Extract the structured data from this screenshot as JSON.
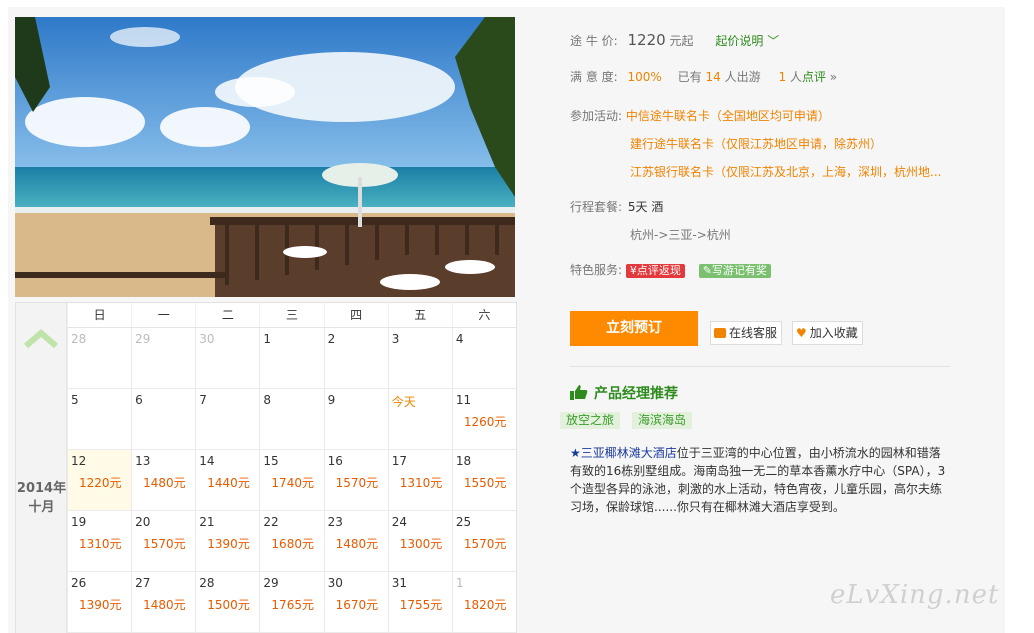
{
  "price_row": {
    "label": "途 牛 价:",
    "price": "1220",
    "unit": "元起",
    "explain": "起价说明"
  },
  "satisfaction_row": {
    "label": "满 意 度:",
    "percent": "100%",
    "prefix": "已有",
    "count": "14",
    "suffix": "人出游",
    "reviews_count": "1",
    "reviews_label": "人点评"
  },
  "activities": {
    "label": "参加活动:",
    "items": [
      "中信途牛联名卡（全国地区均可申请）",
      "建行途牛联名卡（仅限江苏地区申请，除苏州）",
      "江苏银行联名卡（仅限江苏及北京，上海，深圳，杭州地..."
    ]
  },
  "package": {
    "label": "行程套餐:",
    "value": "5天 酒",
    "route": "杭州->三亚->杭州"
  },
  "services": {
    "label": "特色服务:",
    "tag1": "¥点评返现",
    "tag2": "写游记有奖"
  },
  "actions": {
    "book": "立刻预订",
    "service": "在线客服",
    "favorite": "加入收藏"
  },
  "manager": {
    "title": "产品经理推荐",
    "tags": [
      "放空之旅",
      "海滨海岛"
    ],
    "desc_hotel": "★三亚椰林滩大酒店",
    "desc_text": "位于三亚湾的中心位置，由小桥流水的园林和错落有致的16栋别墅组成。海南岛独一无二的草本香薰水疗中心（SPA），3个造型各异的泳池，刺激的水上活动，特色宵夜，儿童乐园，高尔夫练习场，保龄球馆......你只有在椰林滩大酒店享受到。"
  },
  "calendar": {
    "year_label": "2014年",
    "month_label": "十月",
    "weekdays": [
      "日",
      "一",
      "二",
      "三",
      "四",
      "五",
      "六"
    ],
    "weeks": [
      [
        {
          "d": "28",
          "p": "",
          "other": true
        },
        {
          "d": "29",
          "p": "",
          "other": true
        },
        {
          "d": "30",
          "p": "",
          "other": true
        },
        {
          "d": "1",
          "p": ""
        },
        {
          "d": "2",
          "p": ""
        },
        {
          "d": "3",
          "p": ""
        },
        {
          "d": "4",
          "p": ""
        }
      ],
      [
        {
          "d": "5",
          "p": ""
        },
        {
          "d": "6",
          "p": ""
        },
        {
          "d": "7",
          "p": ""
        },
        {
          "d": "8",
          "p": ""
        },
        {
          "d": "9",
          "p": ""
        },
        {
          "d": "今天",
          "p": "",
          "today": true
        },
        {
          "d": "11",
          "p": "1260元"
        }
      ],
      [
        {
          "d": "12",
          "p": "1220元",
          "selected": true
        },
        {
          "d": "13",
          "p": "1480元"
        },
        {
          "d": "14",
          "p": "1440元"
        },
        {
          "d": "15",
          "p": "1740元"
        },
        {
          "d": "16",
          "p": "1570元"
        },
        {
          "d": "17",
          "p": "1310元"
        },
        {
          "d": "18",
          "p": "1550元"
        }
      ],
      [
        {
          "d": "19",
          "p": "1310元"
        },
        {
          "d": "20",
          "p": "1570元"
        },
        {
          "d": "21",
          "p": "1390元"
        },
        {
          "d": "22",
          "p": "1680元"
        },
        {
          "d": "23",
          "p": "1480元"
        },
        {
          "d": "24",
          "p": "1300元"
        },
        {
          "d": "25",
          "p": "1570元"
        }
      ],
      [
        {
          "d": "26",
          "p": "1390元"
        },
        {
          "d": "27",
          "p": "1480元"
        },
        {
          "d": "28",
          "p": "1500元"
        },
        {
          "d": "29",
          "p": "1765元"
        },
        {
          "d": "30",
          "p": "1670元"
        },
        {
          "d": "31",
          "p": "1755元"
        },
        {
          "d": "1",
          "p": "1820元",
          "other": true
        }
      ]
    ]
  },
  "watermark": "eLvXing.net"
}
